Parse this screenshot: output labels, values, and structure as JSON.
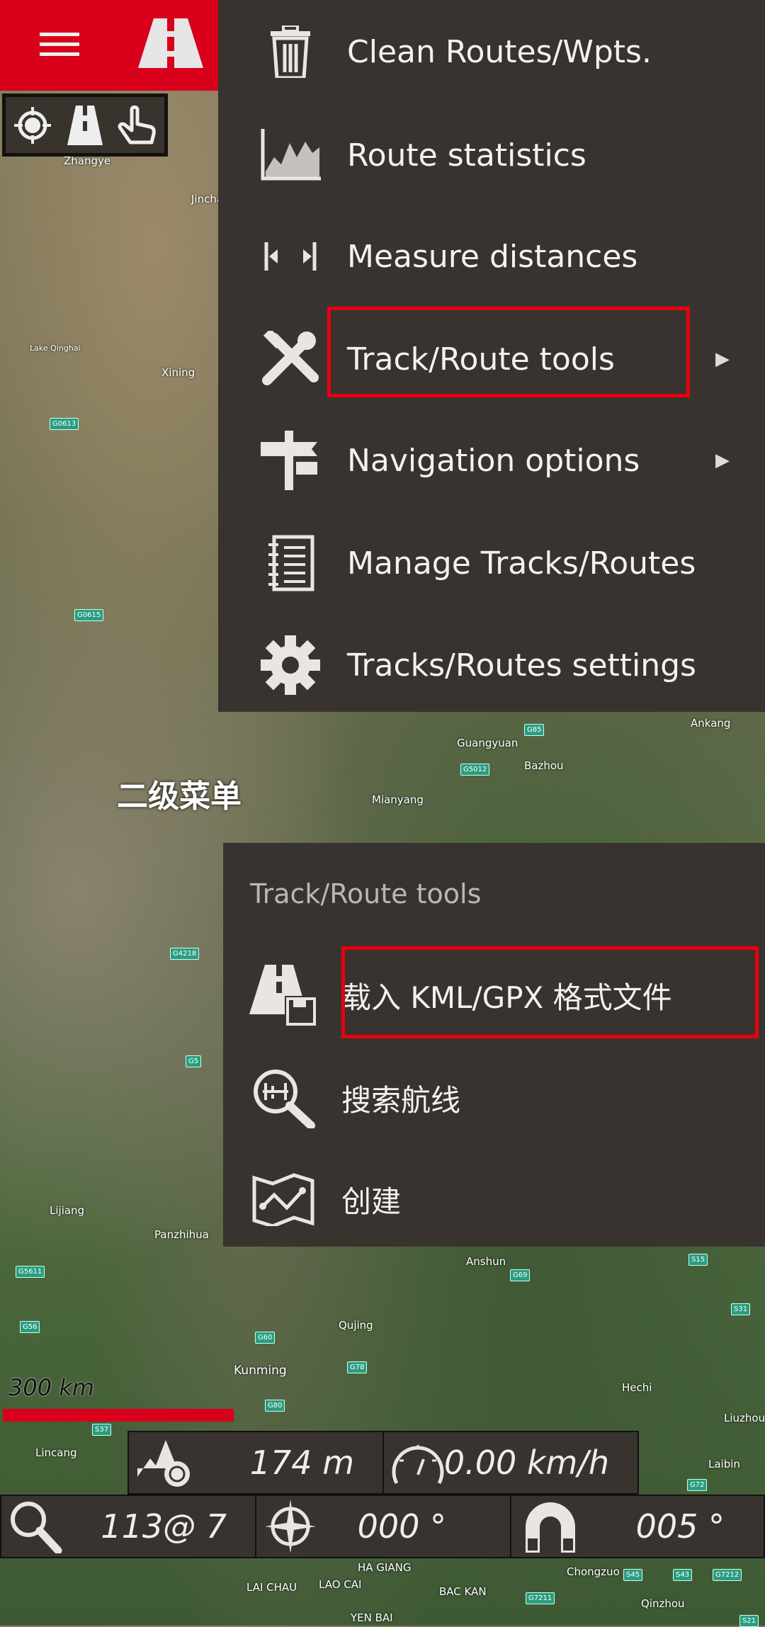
{
  "header": {
    "menu_icon": "hamburger-icon",
    "logo_icon": "road-icon"
  },
  "toolbar": {
    "icons": [
      "crosshair-icon",
      "road-icon",
      "pointer-hand-icon"
    ]
  },
  "menu": {
    "items": [
      {
        "label": "Clean Routes/Wpts.",
        "icon": "trash-icon"
      },
      {
        "label": "Route statistics",
        "icon": "chart-icon"
      },
      {
        "label": "Measure distances",
        "icon": "measure-icon"
      },
      {
        "label": "Track/Route tools",
        "icon": "tools-icon",
        "submenu": true
      },
      {
        "label": "Navigation options",
        "icon": "signpost-icon",
        "submenu": true
      },
      {
        "label": "Manage Tracks/Routes",
        "icon": "notebook-icon"
      },
      {
        "label": "Tracks/Routes settings",
        "icon": "gear-icon"
      }
    ]
  },
  "caption": "二级菜单",
  "submenu": {
    "title": "Track/Route tools",
    "items": [
      {
        "label": "载入 KML/GPX 格式文件",
        "icon": "load-route-icon"
      },
      {
        "label": "搜索航线",
        "icon": "search-route-icon"
      },
      {
        "label": "创建",
        "icon": "map-route-icon"
      }
    ]
  },
  "map": {
    "labels": [
      "Zhangye",
      "Jinchang",
      "Lake Qinghai",
      "Xining",
      "Guangyuan",
      "Bazhou",
      "Mianyang",
      "Ankang",
      "Lijiang",
      "Panzhihua",
      "Anshun",
      "Qujing",
      "Kunming",
      "Hechi",
      "Liuzhou",
      "Laibin",
      "Lincang",
      "HA GIANG",
      "LAI CHAU",
      "LAO CAI",
      "BAC KAN",
      "YEN BAI",
      "Chongzuo",
      "Qinzhou"
    ],
    "roads": [
      "G0613",
      "G0615",
      "G85",
      "G5012",
      "G4218",
      "G5",
      "G5611",
      "G56",
      "G60",
      "G80",
      "G78",
      "S37",
      "G69",
      "S15",
      "S31",
      "G72",
      "G7211",
      "S45",
      "S43",
      "G7212",
      "S21"
    ]
  },
  "scale": {
    "label": "300 km"
  },
  "status": {
    "altitude": "174 m",
    "speed": "0.00 km/h",
    "zoom": "113@ 7",
    "bearing": "000 °",
    "heading": "005 °"
  },
  "colors": {
    "brand": "#d8001a",
    "menu_bg": "#39332f",
    "highlight": "#e8000f"
  }
}
